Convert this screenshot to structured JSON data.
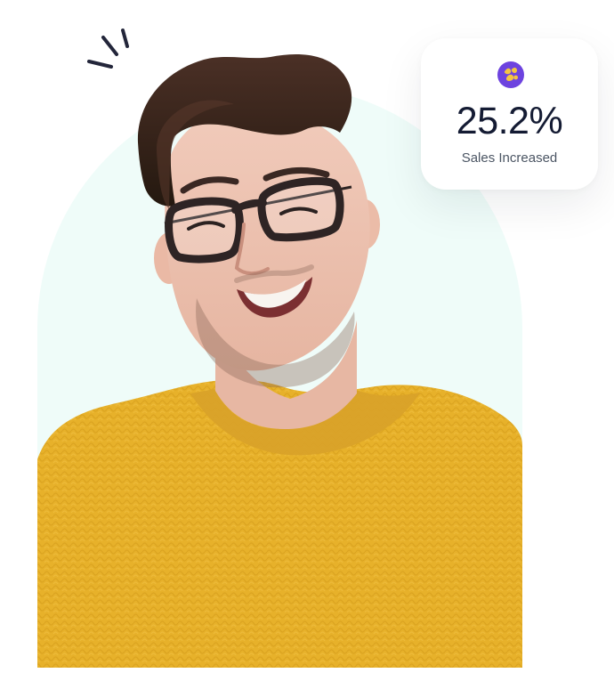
{
  "colors": {
    "background": "#ffffff",
    "arch": "#effcf9",
    "sweater": "#e7b12a",
    "card_text": "#141b33",
    "label_text": "#4b5563",
    "badge": "#6d43df",
    "badge_icon": "#f4c542"
  },
  "stat_card": {
    "icon": "sparkle-badge-icon",
    "value": "25.2%",
    "label": "Sales Increased"
  },
  "decorations": {
    "spark_icon": "spark-lines-icon"
  },
  "photo": {
    "subject": "smiling-man-portrait"
  }
}
